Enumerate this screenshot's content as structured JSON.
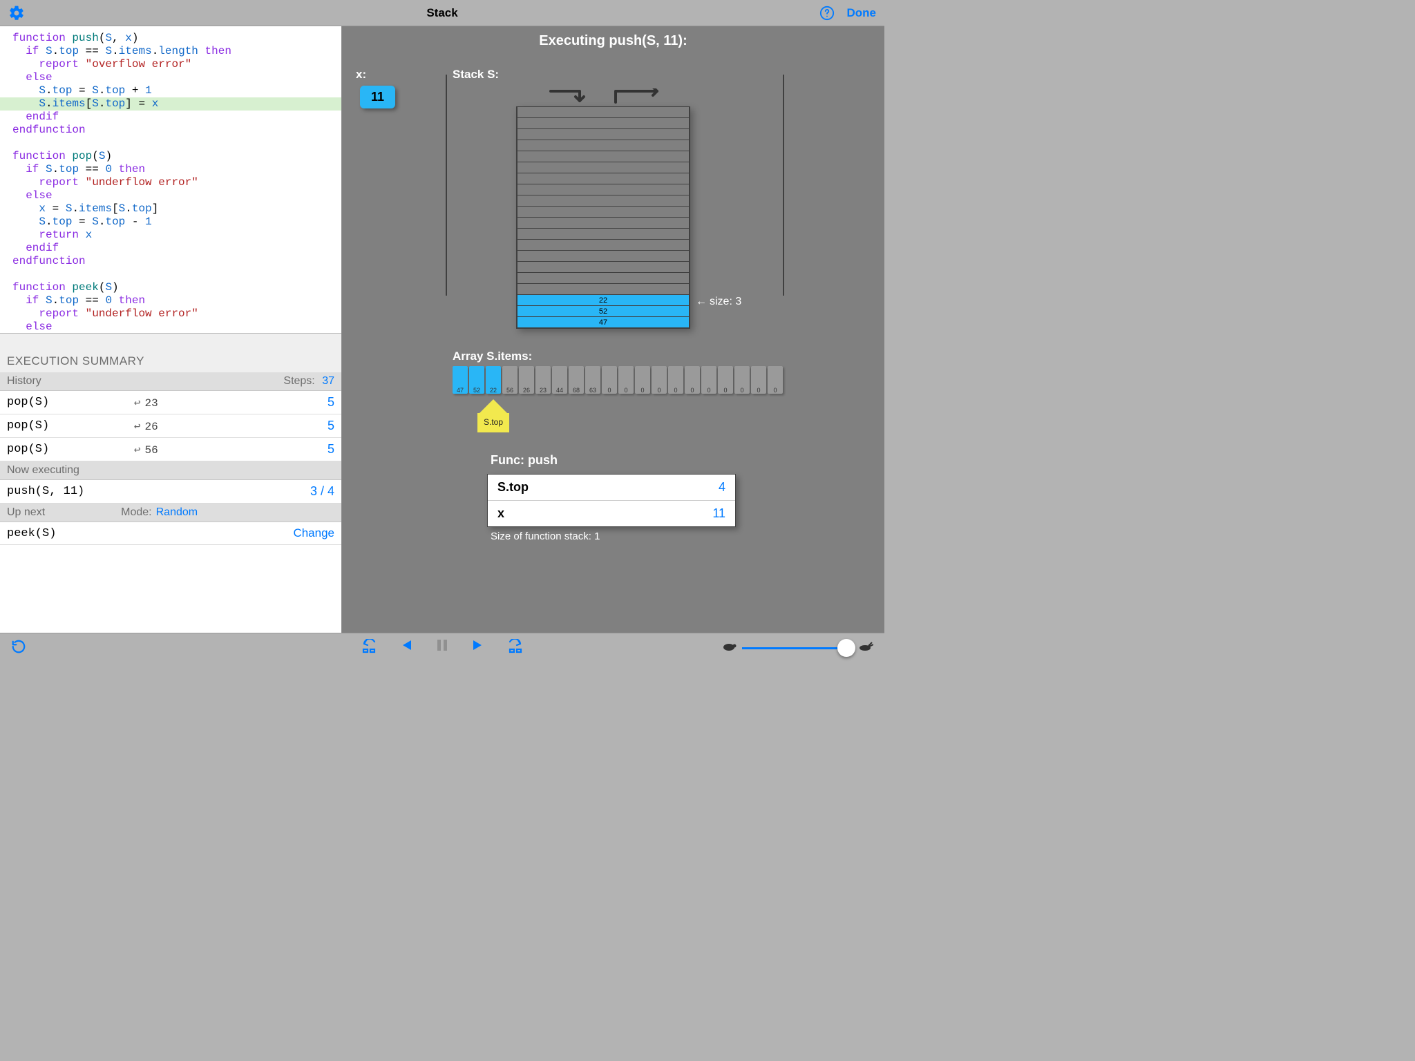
{
  "header": {
    "title": "Stack",
    "done": "Done"
  },
  "code": [
    {
      "i": 0,
      "t": "function push(S, x)"
    },
    {
      "i": 1,
      "t": "  if S.top == S.items.length then"
    },
    {
      "i": 2,
      "t": "    report \"overflow error\""
    },
    {
      "i": 3,
      "t": "  else"
    },
    {
      "i": 4,
      "t": "    S.top = S.top + 1"
    },
    {
      "i": 5,
      "t": "    S.items[S.top] = x",
      "hl": true
    },
    {
      "i": 6,
      "t": "  endif"
    },
    {
      "i": 7,
      "t": "endfunction"
    },
    {
      "i": 8,
      "t": ""
    },
    {
      "i": 9,
      "t": "function pop(S)"
    },
    {
      "i": 10,
      "t": "  if S.top == 0 then"
    },
    {
      "i": 11,
      "t": "    report \"underflow error\""
    },
    {
      "i": 12,
      "t": "  else"
    },
    {
      "i": 13,
      "t": "    x = S.items[S.top]"
    },
    {
      "i": 14,
      "t": "    S.top = S.top - 1"
    },
    {
      "i": 15,
      "t": "    return x"
    },
    {
      "i": 16,
      "t": "  endif"
    },
    {
      "i": 17,
      "t": "endfunction"
    },
    {
      "i": 18,
      "t": ""
    },
    {
      "i": 19,
      "t": "function peek(S)"
    },
    {
      "i": 20,
      "t": "  if S.top == 0 then"
    },
    {
      "i": 21,
      "t": "    report \"underflow error\""
    },
    {
      "i": 22,
      "t": "  else"
    }
  ],
  "summary": {
    "title": "EXECUTION SUMMARY",
    "history_label": "History",
    "steps_label": "Steps:",
    "steps_value": "37",
    "history": [
      {
        "call": "pop(S)",
        "ret": "23",
        "steps": "5"
      },
      {
        "call": "pop(S)",
        "ret": "26",
        "steps": "5"
      },
      {
        "call": "pop(S)",
        "ret": "56",
        "steps": "5"
      }
    ],
    "now_label": "Now executing",
    "now_call": "push(S, 11)",
    "now_progress": "3 / 4",
    "next_label": "Up next",
    "mode_label": "Mode:",
    "mode_value": "Random",
    "next_call": "peek(S)",
    "change": "Change"
  },
  "viz": {
    "executing": "Executing push(S, 11):",
    "x_label": "x:",
    "x_value": "11",
    "stack_label": "Stack S:",
    "size_label": "size: 3",
    "stack_values_top_to_bottom": [
      "22",
      "52",
      "47"
    ],
    "array_label": "Array S.items:",
    "array": [
      {
        "v": "47",
        "f": true
      },
      {
        "v": "52",
        "f": true
      },
      {
        "v": "22",
        "f": true
      },
      {
        "v": "56"
      },
      {
        "v": "26"
      },
      {
        "v": "23"
      },
      {
        "v": "44"
      },
      {
        "v": "68"
      },
      {
        "v": "63"
      },
      {
        "v": "0"
      },
      {
        "v": "0"
      },
      {
        "v": "0"
      },
      {
        "v": "0"
      },
      {
        "v": "0"
      },
      {
        "v": "0"
      },
      {
        "v": "0"
      },
      {
        "v": "0"
      },
      {
        "v": "0"
      },
      {
        "v": "0"
      },
      {
        "v": "0"
      }
    ],
    "pointer_label": "S.top",
    "pointer_index": 2,
    "func_label": "Func: push",
    "func_rows": [
      {
        "k": "S.top",
        "v": "4"
      },
      {
        "k": "x",
        "v": "11"
      }
    ],
    "stack_size_note": "Size of function stack: 1"
  },
  "colors": {
    "accent": "#007aff",
    "highlight": "#29b6f6"
  }
}
